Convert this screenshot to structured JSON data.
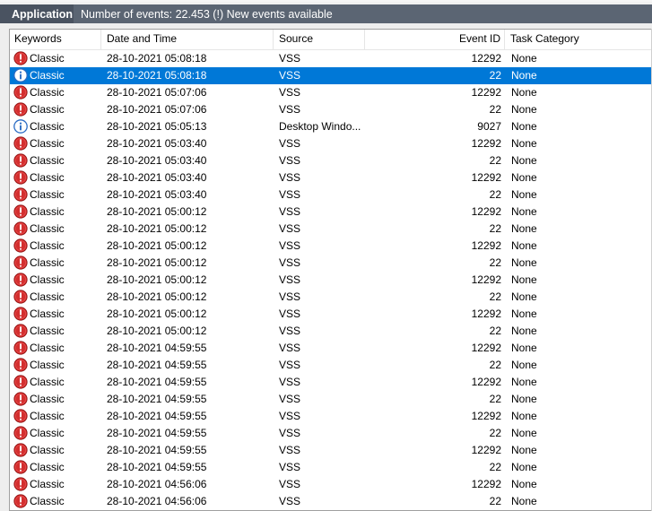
{
  "titlebar": {
    "app_label": "Application",
    "info": "Number of events: 22.453 (!) New events available"
  },
  "columns": [
    "Keywords",
    "Date and Time",
    "Source",
    "Event ID",
    "Task Category"
  ],
  "colors": {
    "selected_bg": "#0078d7",
    "error_icon": "#d32f2f",
    "info_icon": "#2b6cc4"
  },
  "rows": [
    {
      "icon": "error-icon",
      "keyword": "Classic",
      "datetime": "28-10-2021 05:08:18",
      "source": "VSS",
      "event_id": "12292",
      "category": "None",
      "selected": false
    },
    {
      "icon": "info-icon",
      "keyword": "Classic",
      "datetime": "28-10-2021 05:08:18",
      "source": "VSS",
      "event_id": "22",
      "category": "None",
      "selected": true
    },
    {
      "icon": "error-icon",
      "keyword": "Classic",
      "datetime": "28-10-2021 05:07:06",
      "source": "VSS",
      "event_id": "12292",
      "category": "None",
      "selected": false
    },
    {
      "icon": "error-icon",
      "keyword": "Classic",
      "datetime": "28-10-2021 05:07:06",
      "source": "VSS",
      "event_id": "22",
      "category": "None",
      "selected": false
    },
    {
      "icon": "info-icon",
      "keyword": "Classic",
      "datetime": "28-10-2021 05:05:13",
      "source": "Desktop Windo...",
      "event_id": "9027",
      "category": "None",
      "selected": false
    },
    {
      "icon": "error-icon",
      "keyword": "Classic",
      "datetime": "28-10-2021 05:03:40",
      "source": "VSS",
      "event_id": "12292",
      "category": "None",
      "selected": false
    },
    {
      "icon": "error-icon",
      "keyword": "Classic",
      "datetime": "28-10-2021 05:03:40",
      "source": "VSS",
      "event_id": "22",
      "category": "None",
      "selected": false
    },
    {
      "icon": "error-icon",
      "keyword": "Classic",
      "datetime": "28-10-2021 05:03:40",
      "source": "VSS",
      "event_id": "12292",
      "category": "None",
      "selected": false
    },
    {
      "icon": "error-icon",
      "keyword": "Classic",
      "datetime": "28-10-2021 05:03:40",
      "source": "VSS",
      "event_id": "22",
      "category": "None",
      "selected": false
    },
    {
      "icon": "error-icon",
      "keyword": "Classic",
      "datetime": "28-10-2021 05:00:12",
      "source": "VSS",
      "event_id": "12292",
      "category": "None",
      "selected": false
    },
    {
      "icon": "error-icon",
      "keyword": "Classic",
      "datetime": "28-10-2021 05:00:12",
      "source": "VSS",
      "event_id": "22",
      "category": "None",
      "selected": false
    },
    {
      "icon": "error-icon",
      "keyword": "Classic",
      "datetime": "28-10-2021 05:00:12",
      "source": "VSS",
      "event_id": "12292",
      "category": "None",
      "selected": false
    },
    {
      "icon": "error-icon",
      "keyword": "Classic",
      "datetime": "28-10-2021 05:00:12",
      "source": "VSS",
      "event_id": "22",
      "category": "None",
      "selected": false
    },
    {
      "icon": "error-icon",
      "keyword": "Classic",
      "datetime": "28-10-2021 05:00:12",
      "source": "VSS",
      "event_id": "12292",
      "category": "None",
      "selected": false
    },
    {
      "icon": "error-icon",
      "keyword": "Classic",
      "datetime": "28-10-2021 05:00:12",
      "source": "VSS",
      "event_id": "22",
      "category": "None",
      "selected": false
    },
    {
      "icon": "error-icon",
      "keyword": "Classic",
      "datetime": "28-10-2021 05:00:12",
      "source": "VSS",
      "event_id": "12292",
      "category": "None",
      "selected": false
    },
    {
      "icon": "error-icon",
      "keyword": "Classic",
      "datetime": "28-10-2021 05:00:12",
      "source": "VSS",
      "event_id": "22",
      "category": "None",
      "selected": false
    },
    {
      "icon": "error-icon",
      "keyword": "Classic",
      "datetime": "28-10-2021 04:59:55",
      "source": "VSS",
      "event_id": "12292",
      "category": "None",
      "selected": false
    },
    {
      "icon": "error-icon",
      "keyword": "Classic",
      "datetime": "28-10-2021 04:59:55",
      "source": "VSS",
      "event_id": "22",
      "category": "None",
      "selected": false
    },
    {
      "icon": "error-icon",
      "keyword": "Classic",
      "datetime": "28-10-2021 04:59:55",
      "source": "VSS",
      "event_id": "12292",
      "category": "None",
      "selected": false
    },
    {
      "icon": "error-icon",
      "keyword": "Classic",
      "datetime": "28-10-2021 04:59:55",
      "source": "VSS",
      "event_id": "22",
      "category": "None",
      "selected": false
    },
    {
      "icon": "error-icon",
      "keyword": "Classic",
      "datetime": "28-10-2021 04:59:55",
      "source": "VSS",
      "event_id": "12292",
      "category": "None",
      "selected": false
    },
    {
      "icon": "error-icon",
      "keyword": "Classic",
      "datetime": "28-10-2021 04:59:55",
      "source": "VSS",
      "event_id": "22",
      "category": "None",
      "selected": false
    },
    {
      "icon": "error-icon",
      "keyword": "Classic",
      "datetime": "28-10-2021 04:59:55",
      "source": "VSS",
      "event_id": "12292",
      "category": "None",
      "selected": false
    },
    {
      "icon": "error-icon",
      "keyword": "Classic",
      "datetime": "28-10-2021 04:59:55",
      "source": "VSS",
      "event_id": "22",
      "category": "None",
      "selected": false
    },
    {
      "icon": "error-icon",
      "keyword": "Classic",
      "datetime": "28-10-2021 04:56:06",
      "source": "VSS",
      "event_id": "12292",
      "category": "None",
      "selected": false
    },
    {
      "icon": "error-icon",
      "keyword": "Classic",
      "datetime": "28-10-2021 04:56:06",
      "source": "VSS",
      "event_id": "22",
      "category": "None",
      "selected": false
    }
  ]
}
